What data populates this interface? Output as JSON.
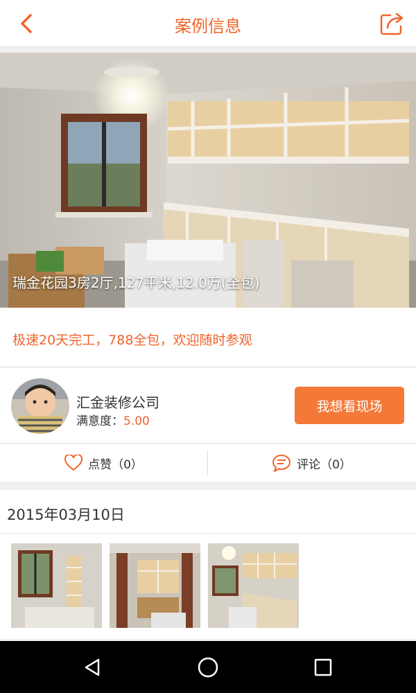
{
  "header": {
    "title": "案例信息",
    "back_icon": "chevron-left-icon",
    "share_icon": "share-icon"
  },
  "hero": {
    "caption": "瑞金花园3房2厅,127平米,12.0万(全包)"
  },
  "promo": {
    "text": "极速20天完工，788全包，欢迎随时参观"
  },
  "company": {
    "name": "汇金装修公司",
    "rating_label": "满意度：",
    "rating_value": "5.00",
    "visit_button": "我想看现场"
  },
  "actions": {
    "like_label": "点赞（0）",
    "comment_label": "评论（0）"
  },
  "gallery": {
    "date": "2015年03月10日",
    "thumbnails": [
      "photo-1",
      "photo-2",
      "photo-3"
    ]
  },
  "theme": {
    "accent": "#f0642a",
    "button": "#f47838"
  }
}
